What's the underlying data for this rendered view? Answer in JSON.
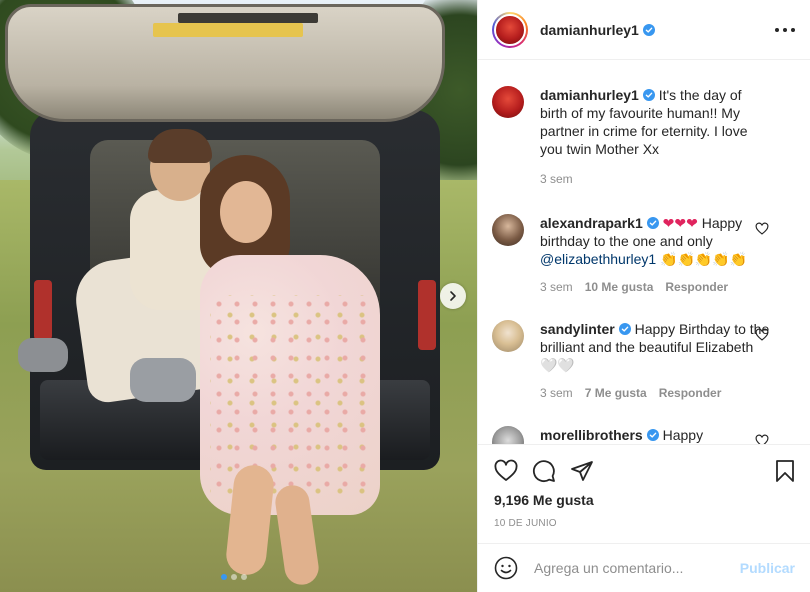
{
  "post": {
    "username": "damianhurley1",
    "more_label": "Más opciones"
  },
  "caption": {
    "username": "damianhurley1",
    "text": "It's the day of birth of my favourite human!! My partner in crime for eternity. I love you twin Mother Xx",
    "time": "3 sem"
  },
  "comments": [
    {
      "username": "alexandrapark1",
      "emoji": "❤❤❤",
      "text_a": " Happy birthday to the one and only ",
      "mention": "@elizabethhurley1",
      "text_b": " 👏👏👏👏👏",
      "time": "3 sem",
      "likes": "10 Me gusta",
      "reply": "Responder"
    },
    {
      "username": "sandylinter",
      "text": " Happy Birthday to the brilliant and the beautiful Elizabeth 🤍🤍",
      "time": "3 sem",
      "likes": "7 Me gusta",
      "reply": "Responder"
    },
    {
      "username": "morellibrothers",
      "text": " Happy"
    }
  ],
  "actions": {
    "likes": "9,196 Me gusta",
    "date": "10 DE JUNIO"
  },
  "add_comment": {
    "placeholder": "Agrega un comentario...",
    "publish": "Publicar"
  },
  "carousel": {
    "count": 3,
    "active": 1
  },
  "colors": {
    "verified": "#3897f0",
    "link": "#00376b",
    "publish_disabled": "#b3dbff"
  }
}
